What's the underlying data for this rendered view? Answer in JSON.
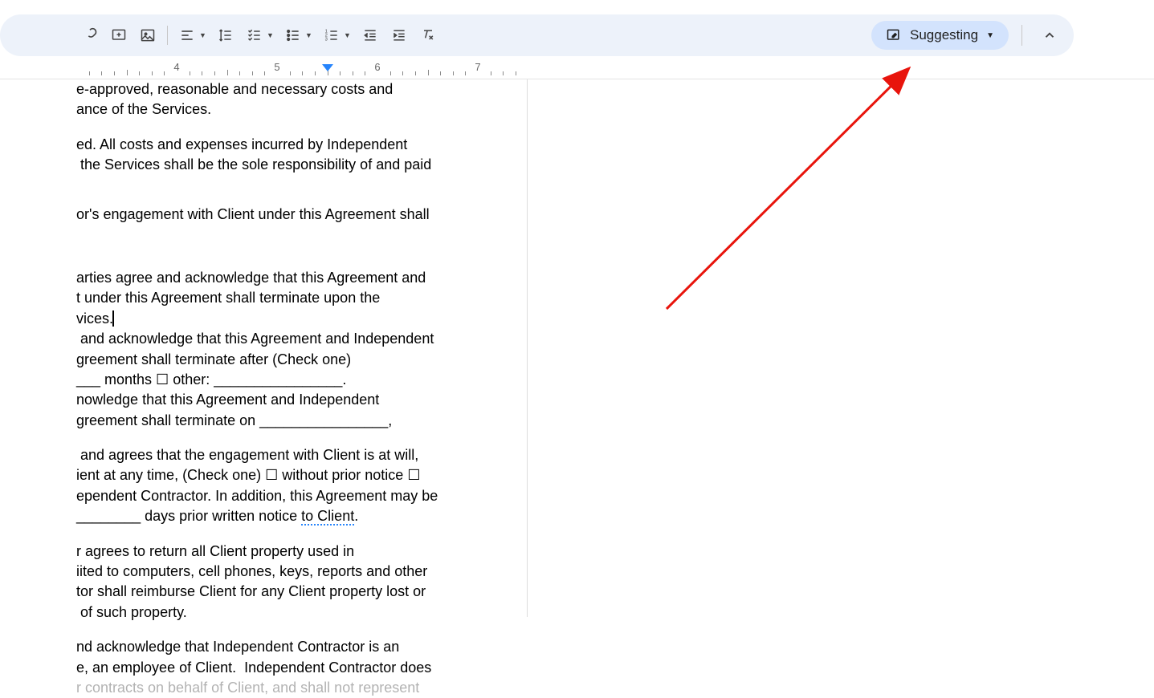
{
  "mode": {
    "label": "Suggesting"
  },
  "ruler": {
    "numbers": [
      4,
      5,
      6,
      7
    ],
    "marker_pos": 5.5
  },
  "doc": {
    "l1": "e-approved, reasonable and necessary costs and",
    "l2": "ance of the Services.",
    "l3": "ed. All costs and expenses incurred by Independent",
    "l4": " the Services shall be the sole responsibility of and paid",
    "l5": "or's engagement with Client under this Agreement shall",
    "l6": "arties agree and acknowledge that this Agreement and",
    "l7": "t under this Agreement shall terminate upon the",
    "l8": "vices.",
    "l9": " and acknowledge that this Agreement and Independent",
    "l10": "greement shall terminate after (Check one)",
    "l11": "___ months ☐ other: ________________.",
    "l12": "nowledge that this Agreement and Independent",
    "l13": "greement shall terminate on ________________,",
    "l14": " and agrees that the engagement with Client is at will,",
    "l15": "ient at any time, (Check one) ☐ without prior notice ☐",
    "l16": "ependent Contractor. In addition, this Agreement may be",
    "l17a": "________ days prior written notice ",
    "l17b": "to Client",
    "l17c": ".",
    "l18": "r agrees to return all Client property used in",
    "l19": "iited to computers, cell phones, keys, reports and other",
    "l20": "tor shall reimburse Client for any Client property lost or",
    "l21": " of such property.",
    "l22": "nd acknowledge that Independent Contractor is an",
    "l23": "e, an employee of Client.  Independent Contractor does",
    "l24": "r contracts on behalf of Client, and shall not represent"
  }
}
